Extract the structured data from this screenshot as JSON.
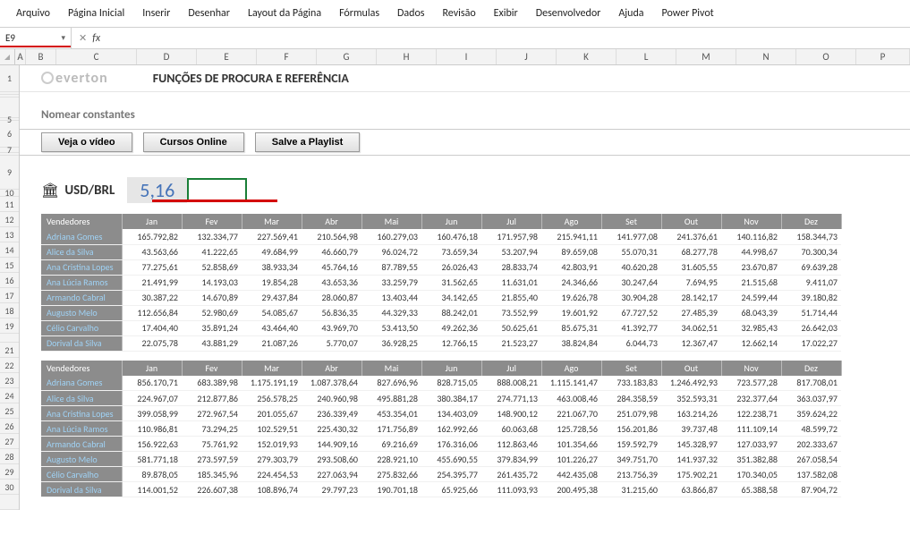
{
  "ribbon": [
    "Arquivo",
    "Página Inicial",
    "Inserir",
    "Desenhar",
    "Layout da Página",
    "Fórmulas",
    "Dados",
    "Revisão",
    "Exibir",
    "Desenvolvedor",
    "Ajuda",
    "Power Pivot"
  ],
  "name_box": "E9",
  "formula_bar": "",
  "columns": [
    "A",
    "B",
    "C",
    "D",
    "E",
    "F",
    "G",
    "H",
    "I",
    "J",
    "K",
    "L",
    "M",
    "N",
    "O",
    "P"
  ],
  "row_headers_top": [
    "1",
    "",
    "",
    "5",
    "6",
    "7",
    "",
    "9",
    "10",
    "11",
    "12",
    "13",
    "14",
    "15",
    "16",
    "17",
    "18",
    "19",
    "",
    "21",
    "22",
    "23",
    "24",
    "25",
    "26",
    "27",
    "28",
    "29",
    "30",
    ""
  ],
  "logo_text": "everton",
  "title": "FUNÇÕES DE PROCURA E REFERÊNCIA",
  "section": "Nomear constantes",
  "buttons": {
    "video": "Veja o vídeo",
    "cursos": "Cursos Online",
    "playlist": "Salve a Playlist"
  },
  "usd": {
    "label": "USD/BRL",
    "value": "5,16"
  },
  "months": [
    "Jan",
    "Fev",
    "Mar",
    "Abr",
    "Mai",
    "Jun",
    "Jul",
    "Ago",
    "Set",
    "Out",
    "Nov",
    "Dez"
  ],
  "vend_header": "Vendedores",
  "table1": [
    {
      "name": "Adriana Gomes",
      "vals": [
        "165.792,82",
        "132.334,77",
        "227.569,41",
        "210.564,98",
        "160.279,03",
        "160.476,18",
        "171.957,98",
        "215.941,11",
        "141.977,08",
        "241.376,61",
        "140.116,82",
        "158.344,73"
      ]
    },
    {
      "name": "Alice da Silva",
      "vals": [
        "43.563,66",
        "41.222,65",
        "49.684,99",
        "46.660,79",
        "96.024,72",
        "73.659,34",
        "53.207,94",
        "89.659,08",
        "55.070,31",
        "68.277,78",
        "44.998,67",
        "70.300,34"
      ]
    },
    {
      "name": "Ana Cristina Lopes",
      "vals": [
        "77.275,61",
        "52.858,69",
        "38.933,34",
        "45.764,16",
        "87.789,55",
        "26.026,43",
        "28.833,74",
        "42.803,91",
        "40.620,28",
        "31.605,55",
        "23.670,87",
        "69.639,28"
      ]
    },
    {
      "name": "Ana Lúcia Ramos",
      "vals": [
        "21.491,99",
        "14.193,03",
        "19.854,28",
        "43.653,36",
        "33.259,79",
        "31.562,65",
        "11.631,01",
        "24.346,66",
        "30.247,64",
        "7.694,95",
        "21.515,68",
        "9.411,07"
      ]
    },
    {
      "name": "Armando Cabral",
      "vals": [
        "30.387,22",
        "14.670,89",
        "29.437,84",
        "28.060,87",
        "13.403,44",
        "34.142,65",
        "21.855,40",
        "19.626,78",
        "30.904,28",
        "28.142,17",
        "24.599,44",
        "39.180,82"
      ]
    },
    {
      "name": "Augusto Melo",
      "vals": [
        "112.656,84",
        "52.980,69",
        "54.085,67",
        "56.836,35",
        "44.329,33",
        "88.242,01",
        "73.552,99",
        "19.601,92",
        "67.727,52",
        "27.485,39",
        "68.043,39",
        "51.714,44"
      ]
    },
    {
      "name": "Célio Carvalho",
      "vals": [
        "17.404,40",
        "35.891,24",
        "43.464,40",
        "43.969,70",
        "53.413,50",
        "49.262,36",
        "50.625,61",
        "85.675,31",
        "41.392,77",
        "34.062,51",
        "32.985,43",
        "26.642,03"
      ]
    },
    {
      "name": "Dorival da Silva",
      "vals": [
        "22.075,78",
        "43.881,29",
        "21.087,26",
        "5.770,07",
        "36.928,25",
        "12.766,15",
        "21.523,27",
        "38.824,84",
        "6.044,73",
        "12.367,47",
        "12.662,14",
        "17.022,27"
      ]
    }
  ],
  "table2": [
    {
      "name": "Adriana Gomes",
      "vals": [
        "856.170,71",
        "683.389,98",
        "1.175.191,19",
        "1.087.378,64",
        "827.696,96",
        "828.715,05",
        "888.008,21",
        "1.115.141,47",
        "733.183,83",
        "1.246.492,93",
        "723.577,28",
        "817.708,01"
      ]
    },
    {
      "name": "Alice da Silva",
      "vals": [
        "224.967,07",
        "212.877,86",
        "256.578,25",
        "240.960,98",
        "495.881,28",
        "380.384,17",
        "274.771,13",
        "463.008,46",
        "284.358,59",
        "352.593,31",
        "232.377,64",
        "363.037,97"
      ]
    },
    {
      "name": "Ana Cristina Lopes",
      "vals": [
        "399.058,99",
        "272.967,54",
        "201.055,67",
        "236.339,49",
        "453.354,01",
        "134.403,09",
        "148.900,12",
        "221.067,70",
        "251.079,98",
        "163.214,26",
        "122.238,71",
        "359.624,22"
      ]
    },
    {
      "name": "Ana Lúcia Ramos",
      "vals": [
        "110.986,81",
        "73.294,25",
        "102.529,51",
        "225.430,32",
        "171.756,89",
        "162.992,66",
        "60.063,68",
        "125.728,56",
        "156.201,86",
        "39.737,48",
        "111.109,14",
        "48.599,72"
      ]
    },
    {
      "name": "Armando Cabral",
      "vals": [
        "156.922,63",
        "75.761,92",
        "152.019,93",
        "144.909,16",
        "69.216,69",
        "176.316,06",
        "112.863,46",
        "101.354,66",
        "159.592,79",
        "145.328,97",
        "127.033,97",
        "202.333,67"
      ]
    },
    {
      "name": "Augusto Melo",
      "vals": [
        "581.771,18",
        "273.597,59",
        "279.303,79",
        "293.508,60",
        "228.921,10",
        "455.690,55",
        "379.834,99",
        "101.226,27",
        "349.751,70",
        "141.937,32",
        "351.382,88",
        "267.058,54"
      ]
    },
    {
      "name": "Célio Carvalho",
      "vals": [
        "89.878,05",
        "185.345,96",
        "224.454,53",
        "227.063,94",
        "275.832,66",
        "254.395,77",
        "261.435,72",
        "442.435,08",
        "213.756,39",
        "175.902,21",
        "170.340,05",
        "137.582,08"
      ]
    },
    {
      "name": "Dorival da Silva",
      "vals": [
        "114.001,52",
        "226.607,38",
        "108.896,74",
        "29.797,23",
        "190.701,18",
        "65.925,66",
        "111.093,93",
        "200.495,38",
        "31.215,60",
        "63.866,87",
        "65.388,58",
        "87.904,72"
      ]
    }
  ]
}
